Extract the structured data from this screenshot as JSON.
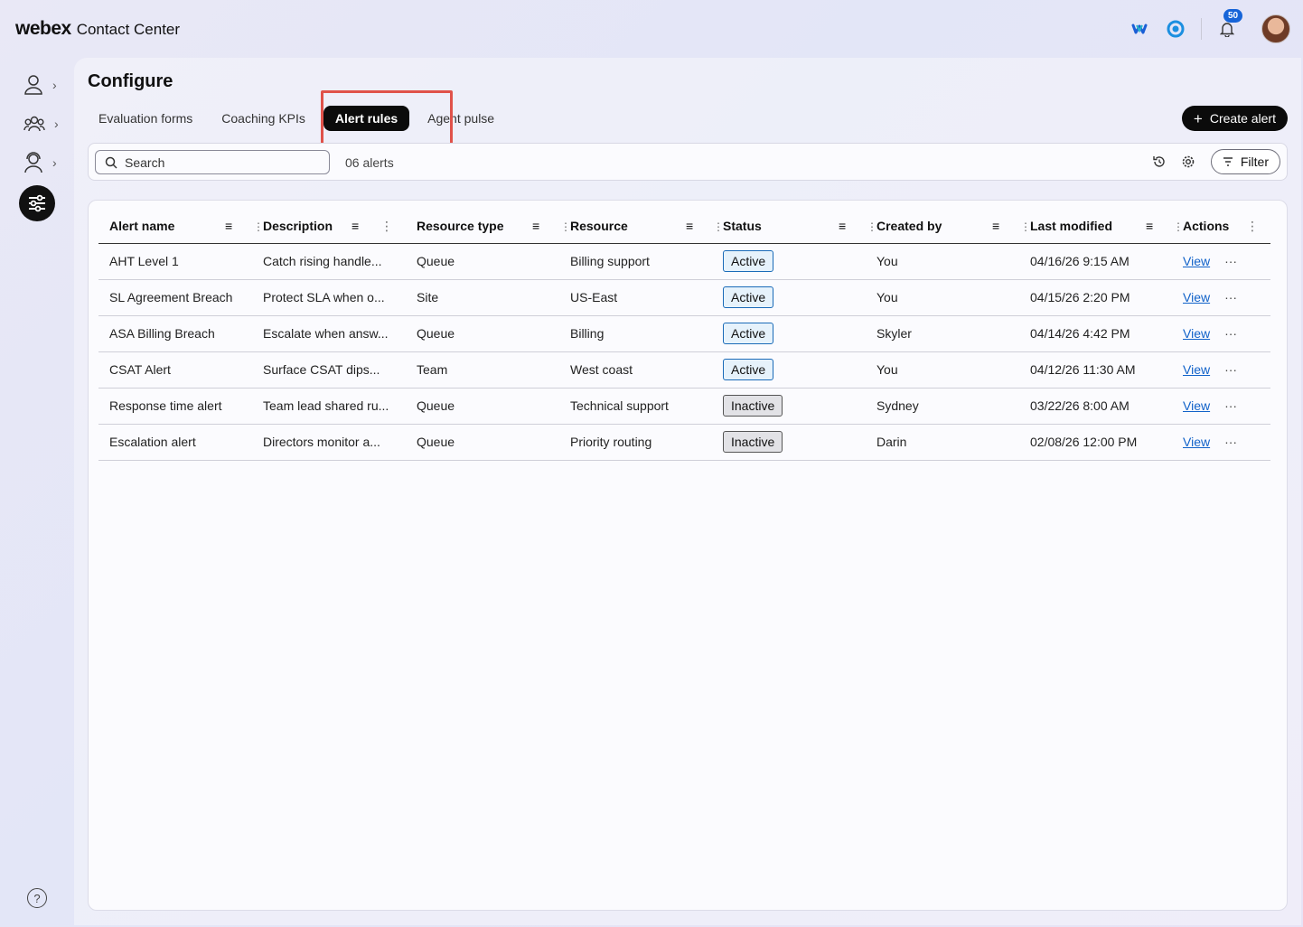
{
  "header": {
    "brand_main": "webex",
    "brand_sub": "Contact Center",
    "notifications_count": "50"
  },
  "page": {
    "title": "Configure",
    "tabs": [
      {
        "label": "Evaluation forms"
      },
      {
        "label": "Coaching KPIs"
      },
      {
        "label": "Alert rules",
        "active": true
      },
      {
        "label": "Agent pulse"
      }
    ],
    "create_button": "Create alert"
  },
  "toolbar": {
    "search_placeholder": "Search",
    "count_label": "06 alerts",
    "filter_label": "Filter"
  },
  "table": {
    "columns": [
      "Alert name",
      "Description",
      "Resource type",
      "Resource",
      "Status",
      "Created by",
      "Last modified",
      "Actions"
    ],
    "rows": [
      {
        "name": "AHT Level 1",
        "description": "Catch rising handle...",
        "resource_type": "Queue",
        "resource": "Billing support",
        "status": "Active",
        "created_by": "You",
        "last_modified": "04/16/26 9:15 AM",
        "action": "View"
      },
      {
        "name": "SL Agreement Breach",
        "description": "Protect SLA when o...",
        "resource_type": "Site",
        "resource": "US-East",
        "status": "Active",
        "created_by": "You",
        "last_modified": "04/15/26 2:20 PM",
        "action": "View"
      },
      {
        "name": "ASA Billing Breach",
        "description": "Escalate when answ...",
        "resource_type": "Queue",
        "resource": "Billing",
        "status": "Active",
        "created_by": "Skyler",
        "last_modified": "04/14/26 4:42 PM",
        "action": "View"
      },
      {
        "name": "CSAT Alert",
        "description": "Surface CSAT dips...",
        "resource_type": "Team",
        "resource": "West coast",
        "status": "Active",
        "created_by": "You",
        "last_modified": "04/12/26 11:30 AM",
        "action": "View"
      },
      {
        "name": "Response time alert",
        "description": "Team lead shared ru...",
        "resource_type": "Queue",
        "resource": "Technical support",
        "status": "Inactive",
        "created_by": "Sydney",
        "last_modified": "03/22/26 8:00 AM",
        "action": "View"
      },
      {
        "name": "Escalation alert",
        "description": "Directors monitor a...",
        "resource_type": "Queue",
        "resource": "Priority routing",
        "status": "Inactive",
        "created_by": "Darin",
        "last_modified": "02/08/26 12:00 PM",
        "action": "View"
      }
    ]
  },
  "colors": {
    "active_status_border": "#1a6bb8",
    "inactive_status_border": "#555555",
    "link": "#1162c9",
    "highlight": "#e0524a"
  }
}
